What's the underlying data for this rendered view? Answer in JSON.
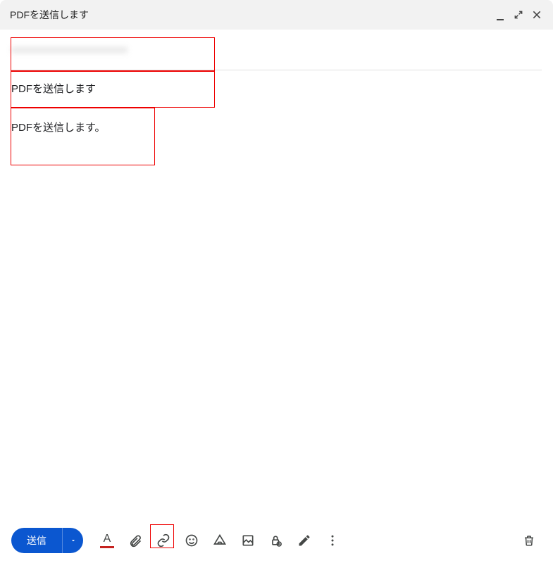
{
  "header": {
    "title": "PDFを送信します"
  },
  "compose": {
    "recipient_obscured": "xxxxxxxxxxxxxxxxxxxxxx",
    "subject": "PDFを送信します",
    "body": "PDFを送信します。"
  },
  "toolbar": {
    "send_label": "送信"
  }
}
